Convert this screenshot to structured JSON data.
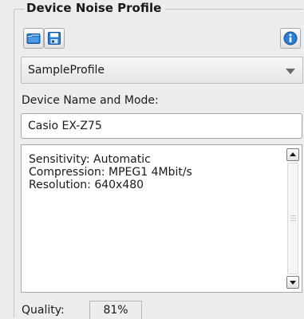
{
  "panel": {
    "title": "Device Noise Profile"
  },
  "toolbar": {
    "open_icon": "folder-open-icon",
    "save_icon": "floppy-save-icon",
    "info_icon": "info-icon",
    "accent_color": "#2c7fd6"
  },
  "profile_select": {
    "selected": "SampleProfile"
  },
  "device": {
    "label": "Device Name and Mode:",
    "value": "Casio EX-Z75"
  },
  "details": {
    "lines": [
      "Sensitivity: Automatic",
      "Compression: MPEG1 4Mbit/s",
      "Resolution: 640x480"
    ]
  },
  "quality": {
    "label": "Quality:",
    "value": "81%"
  }
}
